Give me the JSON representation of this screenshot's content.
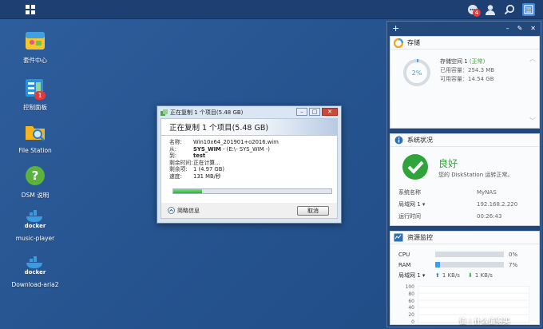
{
  "topbar": {
    "notification_count": "4"
  },
  "desktop": [
    {
      "label": "套件中心",
      "icon": "package-center-icon"
    },
    {
      "label": "控制面板",
      "icon": "control-panel-icon",
      "badge": "1"
    },
    {
      "label": "File Station",
      "icon": "folder-search-icon"
    },
    {
      "label": "DSM 说明",
      "icon": "help-icon"
    },
    {
      "label": "music-player",
      "icon": "docker-icon",
      "brand": "docker"
    },
    {
      "label": "Download-aria2",
      "icon": "docker-icon",
      "brand": "docker"
    }
  ],
  "dialog": {
    "window_title": "正在复制 1 个项目(5.48 GB)",
    "heading": "正在复制 1 个项目(5.48 GB)",
    "rows": [
      {
        "k": "名称:",
        "v": "Win10x64_201901+o2016.wim"
      },
      {
        "k": "从:",
        "v_bold": "SYS_WIM",
        "v": " - (E:\\- SYS_WIM -)"
      },
      {
        "k": "到:",
        "v_bold": "test",
        "v": ""
      },
      {
        "k": "剩余时间:",
        "v": "正在计算..."
      },
      {
        "k": "剩余项:",
        "v": "1 (4.97 GB)"
      },
      {
        "k": "速度:",
        "v": "131 MB/秒"
      }
    ],
    "progress": 0.18,
    "less_info": "简略信息",
    "cancel": "取消"
  },
  "storage": {
    "title": "存储",
    "percent": "2%",
    "percent_value": 2,
    "volume": "存储空间 1",
    "status": "(正常)",
    "used": "已用容量：254.3 MB",
    "available": "可用容量：14.54 GB"
  },
  "system": {
    "title": "系统状况",
    "state": "良好",
    "desc": "您的 DiskStation 运转正常。",
    "rows": [
      {
        "k": "系统名称",
        "v": "MyNAS"
      },
      {
        "k": "局域网 1 ▾",
        "v": "192.168.2.220"
      },
      {
        "k": "运行时间",
        "v": "00:26:43"
      }
    ]
  },
  "monitor": {
    "title": "资源监控",
    "cpu_label": "CPU",
    "cpu_pct": "0%",
    "cpu_value": 0,
    "ram_label": "RAM",
    "ram_pct": "7%",
    "ram_value": 7,
    "lan_label": "局域网 1 ▾",
    "up": "1 KB/s",
    "down": "1 KB/s",
    "chart_ticks": [
      "100",
      "80",
      "60",
      "40",
      "20",
      "0"
    ]
  },
  "watermark": "值 | 什么值得买"
}
